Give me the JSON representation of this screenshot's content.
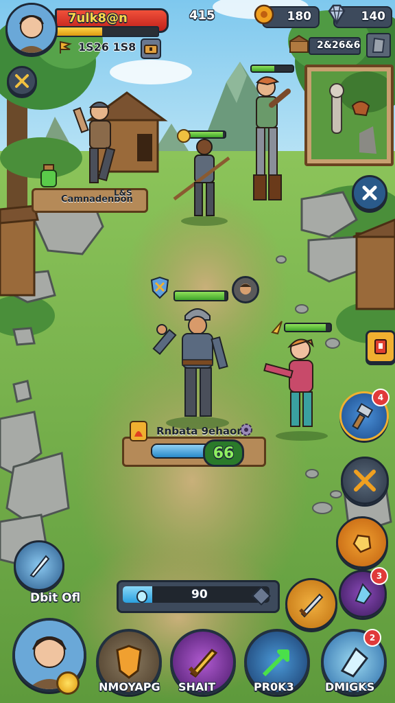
{
  "player": {
    "name": "7ulk8@n",
    "resource_value": "1S26 1S8",
    "power_value": "415",
    "hp_fraction": 0.78,
    "xp_fraction": 0.45
  },
  "currency": {
    "gold_value": "180",
    "gems_value": "140",
    "secondary_value": "2&26&6"
  },
  "labels": {
    "barracks_label": "Camnadenbon",
    "barracks_level": "L&S",
    "hero_nameplate": "Rnbata 9ehaons",
    "hero_level": "66",
    "skill_label": "Dbit Ofl"
  },
  "bars": {
    "energy_value": "90",
    "energy_fraction": 0.2,
    "hero_hp_fraction": 0.95,
    "ally_hp_fraction": 0.8,
    "enemy_a_hp_fraction": 0.95,
    "enemy_b_hp_fraction": 0.55,
    "pink_hp_fraction": 0.9
  },
  "side_badges": {
    "upgrade_badge": "4",
    "magic_badge": "3"
  },
  "bottom_nav": [
    {
      "label": "",
      "icon": "hero-portrait-icon"
    },
    {
      "label": "NMOYAPG",
      "icon": "armor-icon"
    },
    {
      "label": "SHAIT",
      "icon": "sword-icon"
    },
    {
      "label": "PR0K3",
      "icon": "arrow-icon"
    },
    {
      "label": "DMIGKS",
      "icon": "crystal-icon",
      "badge": "2"
    }
  ],
  "colors": {
    "hp_red": "#e0302a",
    "hp_green": "#5ec83a",
    "energy_blue": "#49b6e6",
    "gold": "#f0a020",
    "panel_dark": "#3d4a5c"
  }
}
